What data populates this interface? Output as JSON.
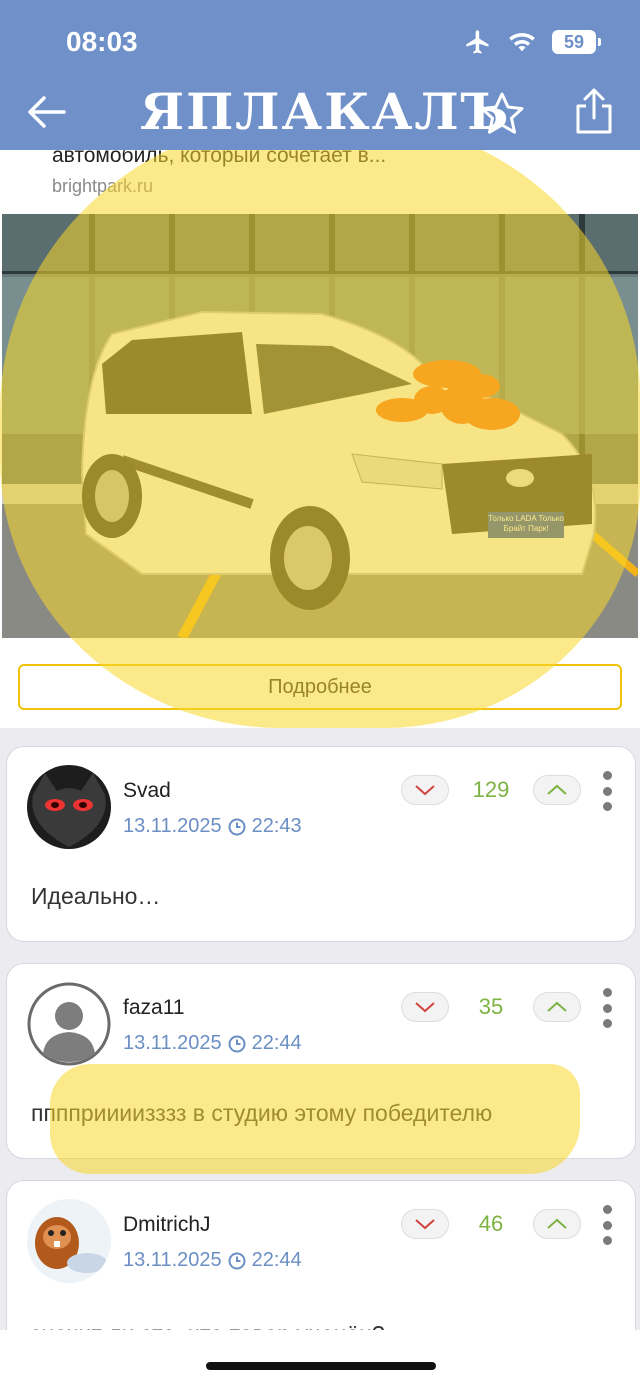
{
  "status_bar": {
    "time": "08:03",
    "battery": "59"
  },
  "header": {
    "logo": "ЯПЛАКАЛЪ"
  },
  "ad": {
    "description": "автомобиль, который сочетает в...",
    "domain": "brightpark.ru",
    "plate_text": "Только LADA Только Брайт Парк!",
    "more_button": "Подробнее"
  },
  "comments": [
    {
      "user": "Svad",
      "date": "13.11.2025",
      "time": "22:43",
      "rating": "129",
      "text": "Идеально…"
    },
    {
      "user": "faza11",
      "date": "13.11.2025",
      "time": "22:44",
      "rating": "35",
      "text": "пппприииизззз в студию этому победителю"
    },
    {
      "user": "DmitrichJ",
      "date": "13.11.2025",
      "time": "22:44",
      "rating": "46",
      "text": "значит ли это, что товар уценён?"
    }
  ],
  "colors": {
    "header": "#6f90c8",
    "highlight": "#fad728",
    "rating": "#7cb342",
    "meta": "#6b8fc4"
  }
}
